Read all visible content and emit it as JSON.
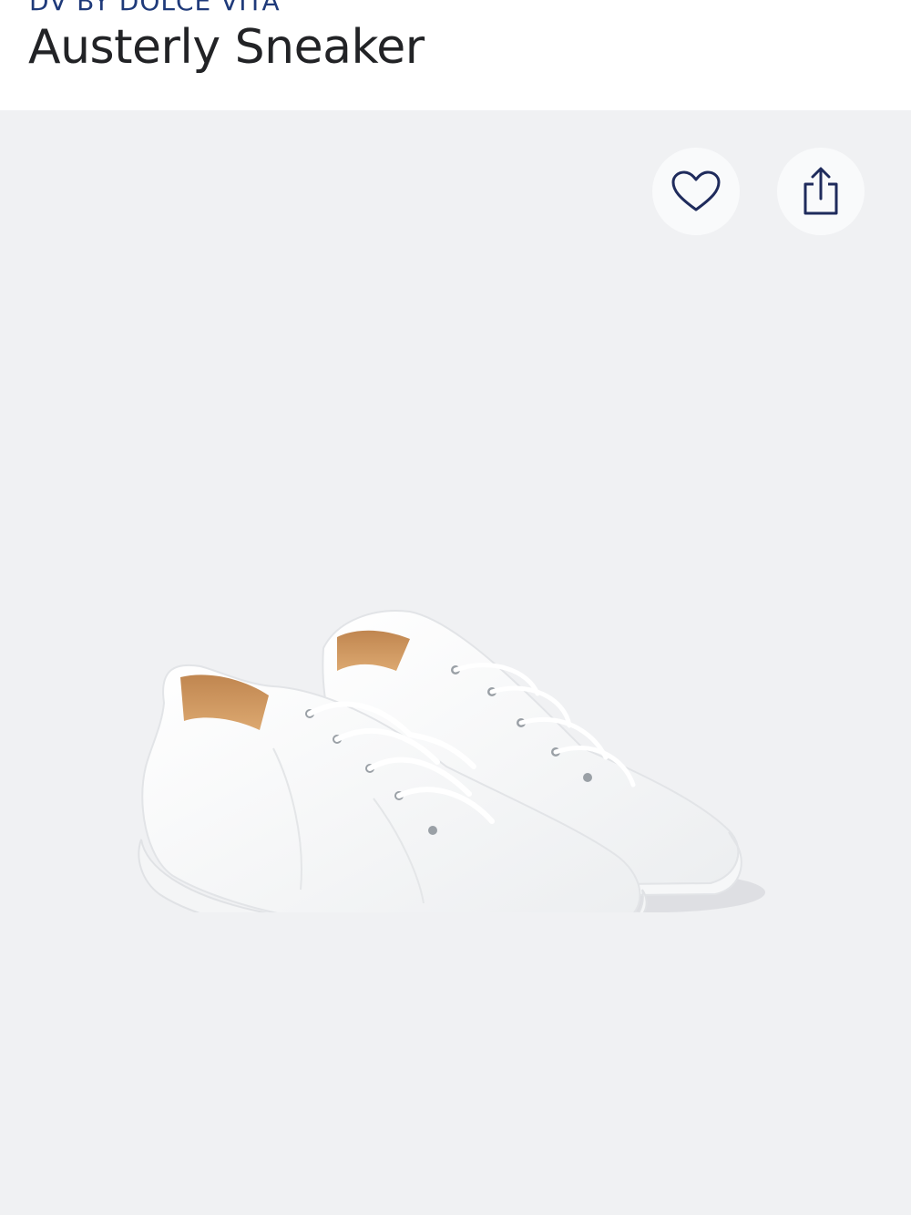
{
  "product": {
    "brand": "DV BY DOLCE VITA",
    "name": "Austerly Sneaker"
  },
  "actions": {
    "favorite_icon": "heart-icon",
    "share_icon": "share-icon"
  },
  "colors": {
    "brand_text": "#1f3a7a",
    "icon_stroke": "#1f2b5c",
    "gallery_background": "#f0f1f3"
  }
}
